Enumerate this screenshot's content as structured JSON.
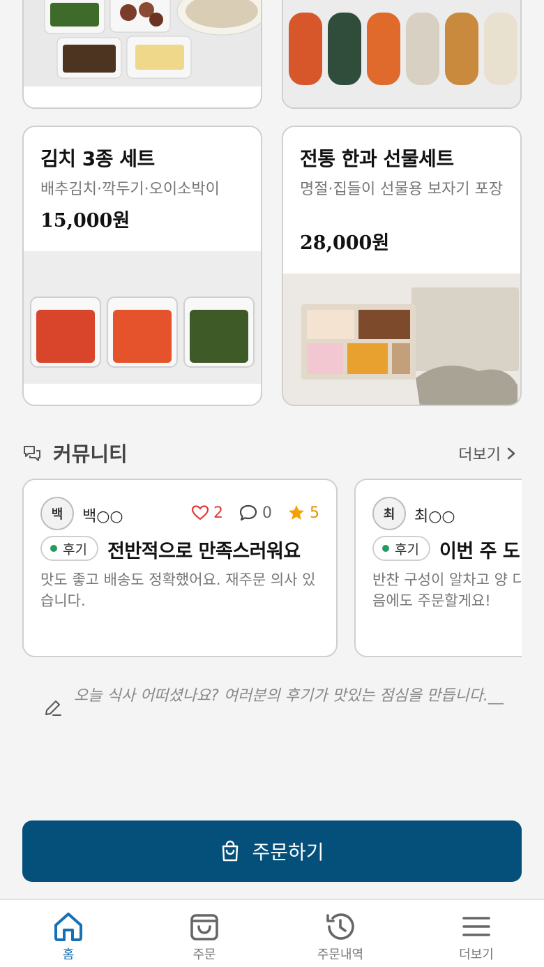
{
  "products": [
    {
      "name": "",
      "desc": "",
      "price": ""
    },
    {
      "name": "",
      "desc": "",
      "price": ""
    },
    {
      "name": "김치 3종 세트",
      "desc": "배추김치·깍두기·오이소박이",
      "price": "15,000원"
    },
    {
      "name": "전통 한과 선물세트",
      "desc": "명절·집들이 선물용 보자기 포장",
      "price": "28,000원"
    }
  ],
  "community": {
    "title": "커뮤니티",
    "more_label": "더보기",
    "reviews": [
      {
        "avatar": "백",
        "author": "백○○",
        "likes": "2",
        "comments": "0",
        "rating": "5",
        "badge": "후기",
        "title": "전반적으로 만족스러워요",
        "body": "맛도 좋고 배송도 정확했어요. 재주문 의사 있습니다."
      },
      {
        "avatar": "최",
        "author": "최○○",
        "badge": "후기",
        "title": "이번 주 도",
        "body": "반찬 구성이 알차고 양 다음에도 주문할게요!"
      }
    ]
  },
  "prompt_text": "오늘 식사 어떠셨나요? 여러분의 후기가 맛있는 점심을 만듭니다.__",
  "order_button_label": "주문하기",
  "nav": {
    "items": [
      {
        "label": "홈",
        "icon": "home-icon",
        "active": true
      },
      {
        "label": "주문",
        "icon": "bag-icon"
      },
      {
        "label": "주문내역",
        "icon": "history-icon"
      },
      {
        "label": "더보기",
        "icon": "menu-icon"
      }
    ]
  },
  "colors": {
    "primary": "#04507a",
    "active_nav": "#1670b5",
    "like": "#e53935",
    "star": "#f5a100",
    "badge_dot": "#1f9d5c"
  }
}
